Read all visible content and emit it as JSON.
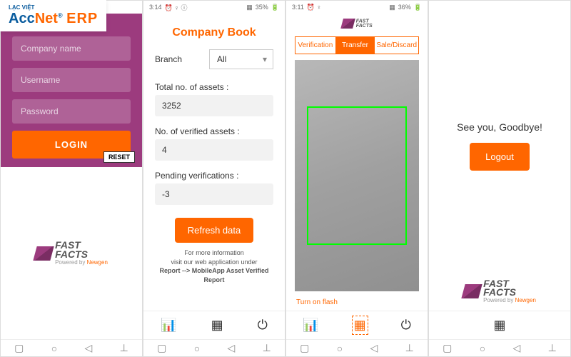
{
  "overlay_logo": {
    "lacviet": "LẠC VIỆT",
    "acc": "Acc",
    "net": "Net",
    "reg": "®",
    "erp": "ERP"
  },
  "status": {
    "p1": {
      "time": "",
      "battery": ""
    },
    "p2": {
      "time": "3:14",
      "battery": "35%"
    },
    "p3": {
      "time": "3:11",
      "battery": "36%"
    },
    "p4": {
      "time": "",
      "battery": ""
    }
  },
  "login": {
    "company_ph": "Company name",
    "user_ph": "Username",
    "pass_ph": "Password",
    "login_label": "LOGIN",
    "reset_label": "RESET"
  },
  "brand": {
    "name_l1": "FAST",
    "name_l2": "FACTS",
    "powered": "Powered by ",
    "newgen": "Newgen"
  },
  "companybook": {
    "title": "Company Book",
    "branch_label": "Branch",
    "branch_value": "All",
    "total_label": "Total no. of assets :",
    "total_value": "3252",
    "verified_label": "No. of verified assets :",
    "verified_value": "4",
    "pending_label": "Pending verifications :",
    "pending_value": "-3",
    "refresh_label": "Refresh data",
    "info_l1": "For more information",
    "info_l2": "visit our web application under",
    "info_l3": "Report --> MobileApp Asset Verified Report"
  },
  "scanner": {
    "tabs": {
      "verification": "Verification",
      "transfer": "Transfer",
      "sale": "Sale/Discard"
    },
    "flash_label": "Turn on flash"
  },
  "logout": {
    "goodbye": "See you, Goodbye!",
    "logout_label": "Logout"
  },
  "nav_glyphs": {
    "square": "▢",
    "circle": "○",
    "tri": "◁",
    "person": "⊥"
  },
  "tab_glyphs": {
    "chart": "📊",
    "qr": "▦",
    "power": "⏻"
  }
}
